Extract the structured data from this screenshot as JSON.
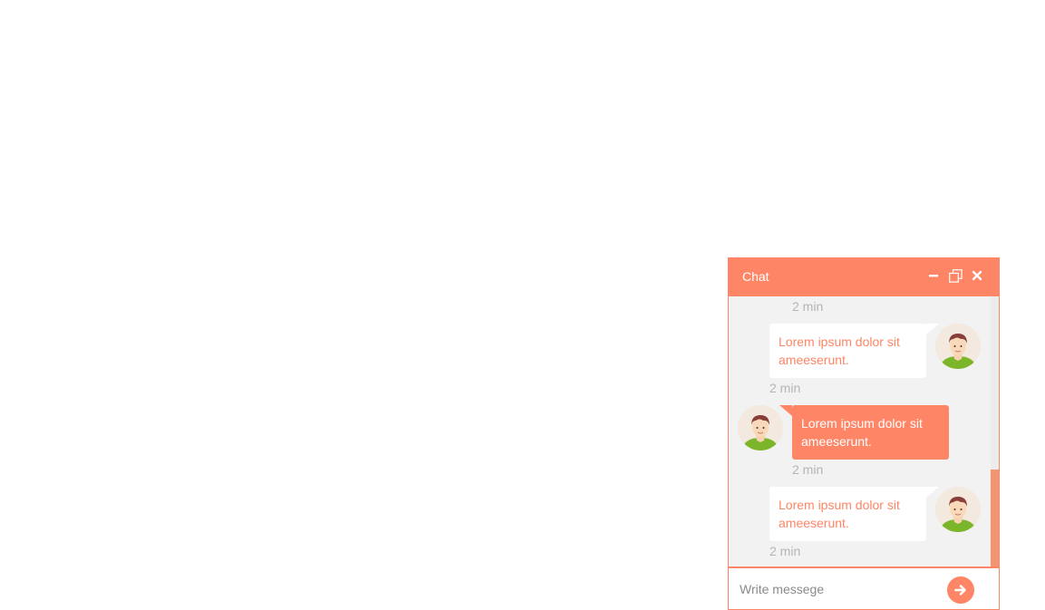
{
  "header": {
    "title": "Chat",
    "icons": [
      "minimize-icon",
      "restore-icon",
      "close-icon"
    ]
  },
  "messages": [
    {
      "direction": "in",
      "time": "2 min"
    },
    {
      "direction": "out",
      "text": "Lorem ipsum dolor sit ameeserunt.",
      "time": "2 min"
    },
    {
      "direction": "in",
      "text": "Lorem ipsum dolor sit ameeserunt.",
      "time": "2 min"
    },
    {
      "direction": "out",
      "text": "Lorem ipsum dolor sit ameeserunt.",
      "time": "2 min"
    }
  ],
  "composer": {
    "placeholder": "Write messege",
    "send_icon": "arrow-right-icon"
  },
  "colors": {
    "accent": "#fe8566",
    "body_bg": "#f2f2f2",
    "time_text": "#b5b5b5",
    "scroll_thumb": "#f59472"
  }
}
